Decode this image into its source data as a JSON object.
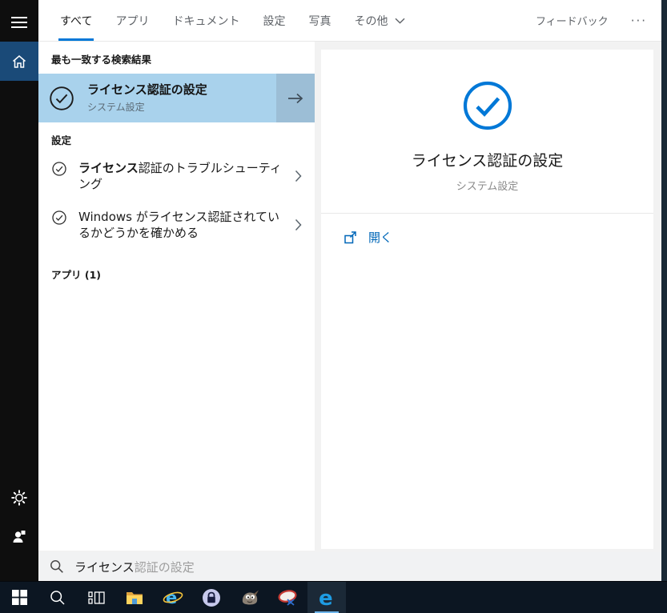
{
  "colors": {
    "accent": "#0078d7",
    "best_match_bg": "#a9d2ec",
    "best_match_arrow_bg": "#9cbed6",
    "rail_highlight": "#1a4a78",
    "taskbar_bg": "#0c1622",
    "edge_underline": "#6db5ec"
  },
  "tabs": {
    "items": [
      {
        "label": "すべて",
        "selected": true
      },
      {
        "label": "アプリ"
      },
      {
        "label": "ドキュメント"
      },
      {
        "label": "設定"
      },
      {
        "label": "写真"
      },
      {
        "label": "その他",
        "has_chevron": true
      }
    ],
    "feedback_label": "フィードバック",
    "more_label": "···"
  },
  "results": {
    "best_match_header": "最も一致する検索結果",
    "best_match": {
      "title": "ライセンス認証の設定",
      "subtitle": "システム設定"
    },
    "settings_header": "設定",
    "settings_items": [
      {
        "bold": "ライセンス",
        "rest": "認証のトラブルシューティング"
      },
      {
        "bold": "",
        "rest": "Windows がライセンス認証されているかどうかを確かめる"
      }
    ],
    "apps_header": "アプリ (1)"
  },
  "preview": {
    "title": "ライセンス認証の設定",
    "subtitle": "システム設定",
    "open_label": "開く"
  },
  "search": {
    "typed": "ライセンス",
    "suggestion": "認証の設定"
  },
  "rail": {
    "items": [
      "menu",
      "home",
      "settings",
      "account"
    ]
  },
  "taskbar": {
    "icons": [
      "start",
      "search",
      "task-view",
      "file-explorer",
      "internet-explorer",
      "keepass",
      "gimp",
      "image-app",
      "edge"
    ],
    "active": "edge"
  }
}
